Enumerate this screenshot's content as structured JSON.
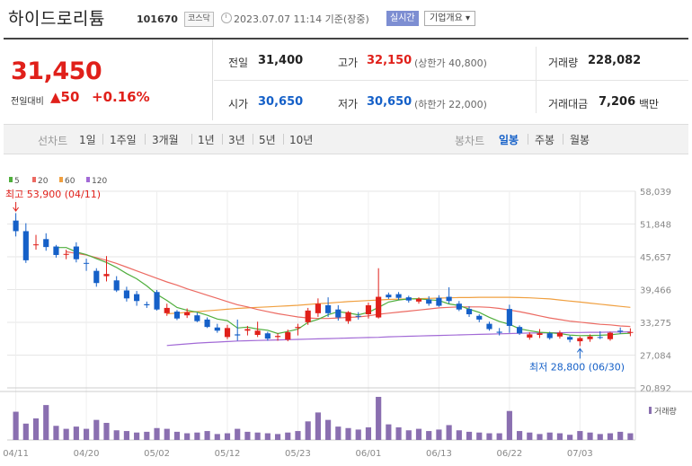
{
  "header": {
    "stock_name": "하이드로리튬",
    "stock_code": "101670",
    "market_badge": "코스닥",
    "datetime": "2023.07.07 11:14 기준(장중)",
    "realtime_btn": "실시간",
    "corp_info_btn": "기업개요 ▾",
    "clock_icon": "clock-icon"
  },
  "quote": {
    "price": "31,450",
    "compare_label": "전일대비",
    "change": "▲50",
    "change_pct": "+0.16%",
    "prev_close_label": "전일",
    "prev_close": "31,400",
    "high_label": "고가",
    "high": "32,150",
    "upper_limit": "(상한가 40,800)",
    "volume_label": "거래량",
    "volume": "228,082",
    "open_label": "시가",
    "open": "30,650",
    "low_label": "저가",
    "low": "30,650",
    "lower_limit": "(하한가 22,000)",
    "amount_label": "거래대금",
    "amount": "7,206",
    "amount_unit": "백만"
  },
  "tabs": {
    "line_label": "선차트",
    "line_items": [
      "1일",
      "1주일",
      "3개월",
      "1년",
      "3년",
      "5년",
      "10년"
    ],
    "candle_label": "봉차트",
    "candle_items": [
      "일봉",
      "주봉",
      "월봉"
    ],
    "active_candle": "일봉"
  },
  "chart_data": {
    "type": "candlestick",
    "legend": [
      "5",
      "20",
      "60",
      "120"
    ],
    "colors": {
      "up": "#e0201a",
      "down": "#1560c8",
      "ma5": "#4fae3c",
      "ma20": "#ec6a62",
      "ma60": "#f0a040",
      "ma120": "#a26ad6",
      "volume": "#8a6fb0"
    },
    "y_ticks": [
      "58,039",
      "51,848",
      "45,657",
      "39,466",
      "33,275",
      "27,084",
      "20,892"
    ],
    "ylim": [
      20892,
      58039
    ],
    "x_labels": [
      "04/11",
      "04/20",
      "05/02",
      "05/12",
      "05/23",
      "06/01",
      "06/13",
      "06/22",
      "07/03"
    ],
    "x_label_index": [
      0,
      7,
      14,
      21,
      28,
      35,
      42,
      49,
      56
    ],
    "high_annotation": "최고 53,900 (04/11)",
    "low_annotation": "최저 28,800 (06/30)",
    "volume_label": "거래량",
    "candles": [
      [
        52500,
        53900,
        49500,
        50500
      ],
      [
        50500,
        52000,
        44500,
        45000
      ],
      [
        48000,
        49800,
        47000,
        48000
      ],
      [
        49000,
        50100,
        46800,
        47500
      ],
      [
        47600,
        47900,
        45500,
        46000
      ],
      [
        46200,
        47000,
        45200,
        46200
      ],
      [
        47600,
        48400,
        44600,
        45200
      ],
      [
        44500,
        45300,
        43000,
        44400
      ],
      [
        43000,
        43500,
        40000,
        40700
      ],
      [
        42000,
        45800,
        41000,
        42400
      ],
      [
        41200,
        42000,
        39000,
        39300
      ],
      [
        39300,
        40000,
        37200,
        37800
      ],
      [
        38600,
        39200,
        36400,
        37300
      ],
      [
        36700,
        37200,
        36000,
        36500
      ],
      [
        39000,
        39400,
        35500,
        35700
      ],
      [
        35000,
        36800,
        34500,
        36000
      ],
      [
        35300,
        35600,
        33700,
        34000
      ],
      [
        34600,
        35900,
        34100,
        35200
      ],
      [
        34600,
        35100,
        33300,
        33500
      ],
      [
        33800,
        34200,
        32200,
        32400
      ],
      [
        32300,
        33000,
        31300,
        31700
      ],
      [
        30500,
        32800,
        30100,
        32200
      ],
      [
        31000,
        33800,
        29800,
        30800
      ],
      [
        31700,
        32600,
        30800,
        32000
      ],
      [
        30900,
        33400,
        30500,
        31700
      ],
      [
        31200,
        31500,
        29800,
        30200
      ],
      [
        30500,
        31200,
        29800,
        30700
      ],
      [
        30000,
        31900,
        29700,
        31400
      ],
      [
        32200,
        33000,
        30800,
        32400
      ],
      [
        33300,
        36000,
        32800,
        35500
      ],
      [
        35000,
        37800,
        34300,
        36800
      ],
      [
        36500,
        38000,
        34300,
        35000
      ],
      [
        35700,
        36500,
        33600,
        34200
      ],
      [
        33500,
        35400,
        33000,
        35200
      ],
      [
        34500,
        35200,
        33800,
        34400
      ],
      [
        34800,
        37000,
        34000,
        36500
      ],
      [
        34200,
        43500,
        34000,
        38100
      ],
      [
        38500,
        38900,
        37700,
        38000
      ],
      [
        38600,
        39000,
        37500,
        37900
      ],
      [
        38000,
        38300,
        37000,
        37400
      ],
      [
        37200,
        38000,
        36800,
        37700
      ],
      [
        37600,
        38200,
        36400,
        36800
      ],
      [
        37900,
        38400,
        36200,
        36400
      ],
      [
        38100,
        39900,
        36800,
        37300
      ],
      [
        36800,
        37300,
        35400,
        35700
      ],
      [
        35800,
        36300,
        34300,
        34800
      ],
      [
        34500,
        34800,
        33300,
        33800
      ],
      [
        33000,
        33400,
        31700,
        32000
      ],
      [
        31500,
        32200,
        30800,
        31300
      ],
      [
        35800,
        36600,
        31300,
        32600
      ],
      [
        32400,
        32700,
        30900,
        31200
      ],
      [
        30400,
        31400,
        30000,
        31000
      ],
      [
        30900,
        32000,
        30300,
        31200
      ],
      [
        31200,
        31500,
        30000,
        30300
      ],
      [
        30600,
        31700,
        30200,
        31300
      ],
      [
        30500,
        30800,
        29500,
        30000
      ],
      [
        29700,
        30600,
        28800,
        30300
      ],
      [
        30100,
        31000,
        29600,
        30600
      ],
      [
        30500,
        31600,
        30100,
        30400
      ],
      [
        30100,
        31500,
        29800,
        31300
      ],
      [
        31700,
        32300,
        31100,
        31500
      ],
      [
        31400,
        32150,
        30650,
        31450
      ]
    ],
    "volumes": [
      38,
      22,
      29,
      47,
      19,
      15,
      18,
      15,
      27,
      23,
      13,
      12,
      10,
      11,
      16,
      15,
      11,
      9,
      10,
      12,
      8,
      9,
      15,
      11,
      10,
      9,
      8,
      10,
      12,
      25,
      37,
      27,
      18,
      16,
      14,
      17,
      58,
      21,
      17,
      13,
      15,
      12,
      14,
      20,
      13,
      11,
      10,
      9,
      9,
      39,
      12,
      10,
      8,
      10,
      9,
      7,
      12,
      10,
      8,
      9,
      11,
      9
    ],
    "ma5": [
      null,
      null,
      null,
      null,
      47400,
      47400,
      46580,
      46060,
      45300,
      44580,
      43640,
      42480,
      41500,
      40160,
      38580,
      37410,
      36070,
      35550,
      35190,
      34610,
      33900,
      33590,
      32200,
      32370,
      32000,
      31790,
      31160,
      31540,
      31980,
      33280,
      33830,
      34700,
      35300,
      35040,
      34700,
      35160,
      36100,
      37100,
      37500,
      37700,
      37700,
      37550,
      37390,
      36760,
      36440,
      35770,
      35160,
      34220,
      33420,
      32900,
      32050,
      31700,
      31400,
      31300,
      31160,
      30860,
      30760,
      30800,
      30840,
      30920,
      31120,
      31200
    ],
    "ma20": [
      null,
      null,
      null,
      null,
      null,
      46600,
      46300,
      46000,
      45500,
      45000,
      44400,
      43700,
      43000,
      42300,
      41600,
      40900,
      40300,
      39600,
      39000,
      38400,
      37800,
      37200,
      36600,
      36200,
      35700,
      35300,
      34900,
      34600,
      34300,
      34100,
      34000,
      34000,
      34100,
      34200,
      34300,
      34500,
      34800,
      35000,
      35200,
      35400,
      35600,
      35800,
      36000,
      36100,
      36200,
      36200,
      36200,
      36100,
      35900,
      35600,
      35300,
      34900,
      34500,
      34100,
      33800,
      33500,
      33300,
      33100,
      32900,
      32800,
      32600,
      32500
    ],
    "ma60": [
      null,
      null,
      null,
      null,
      null,
      null,
      null,
      null,
      null,
      null,
      null,
      null,
      null,
      null,
      null,
      34900,
      35000,
      35150,
      35300,
      35450,
      35600,
      35750,
      35900,
      36000,
      36100,
      36200,
      36300,
      36400,
      36500,
      36650,
      36800,
      36900,
      37050,
      37200,
      37300,
      37400,
      37500,
      37600,
      37650,
      37700,
      37750,
      37800,
      37850,
      37900,
      37950,
      37950,
      38000,
      38000,
      38000,
      38000,
      37950,
      37900,
      37800,
      37700,
      37500,
      37300,
      37100,
      36900,
      36700,
      36500,
      36300,
      36100
    ],
    "ma120": [
      null,
      null,
      null,
      null,
      null,
      null,
      null,
      null,
      null,
      null,
      null,
      null,
      null,
      null,
      null,
      28900,
      29050,
      29200,
      29350,
      29450,
      29550,
      29650,
      29750,
      29800,
      29850,
      29900,
      29950,
      30000,
      30050,
      30100,
      30150,
      30200,
      30250,
      30300,
      30350,
      30400,
      30450,
      30550,
      30600,
      30650,
      30700,
      30750,
      30800,
      30850,
      30900,
      30950,
      31000,
      31050,
      31100,
      31150,
      31200,
      31250,
      31250,
      31300,
      31300,
      31350,
      31350,
      31400,
      31400,
      31450,
      31450,
      31500
    ]
  }
}
